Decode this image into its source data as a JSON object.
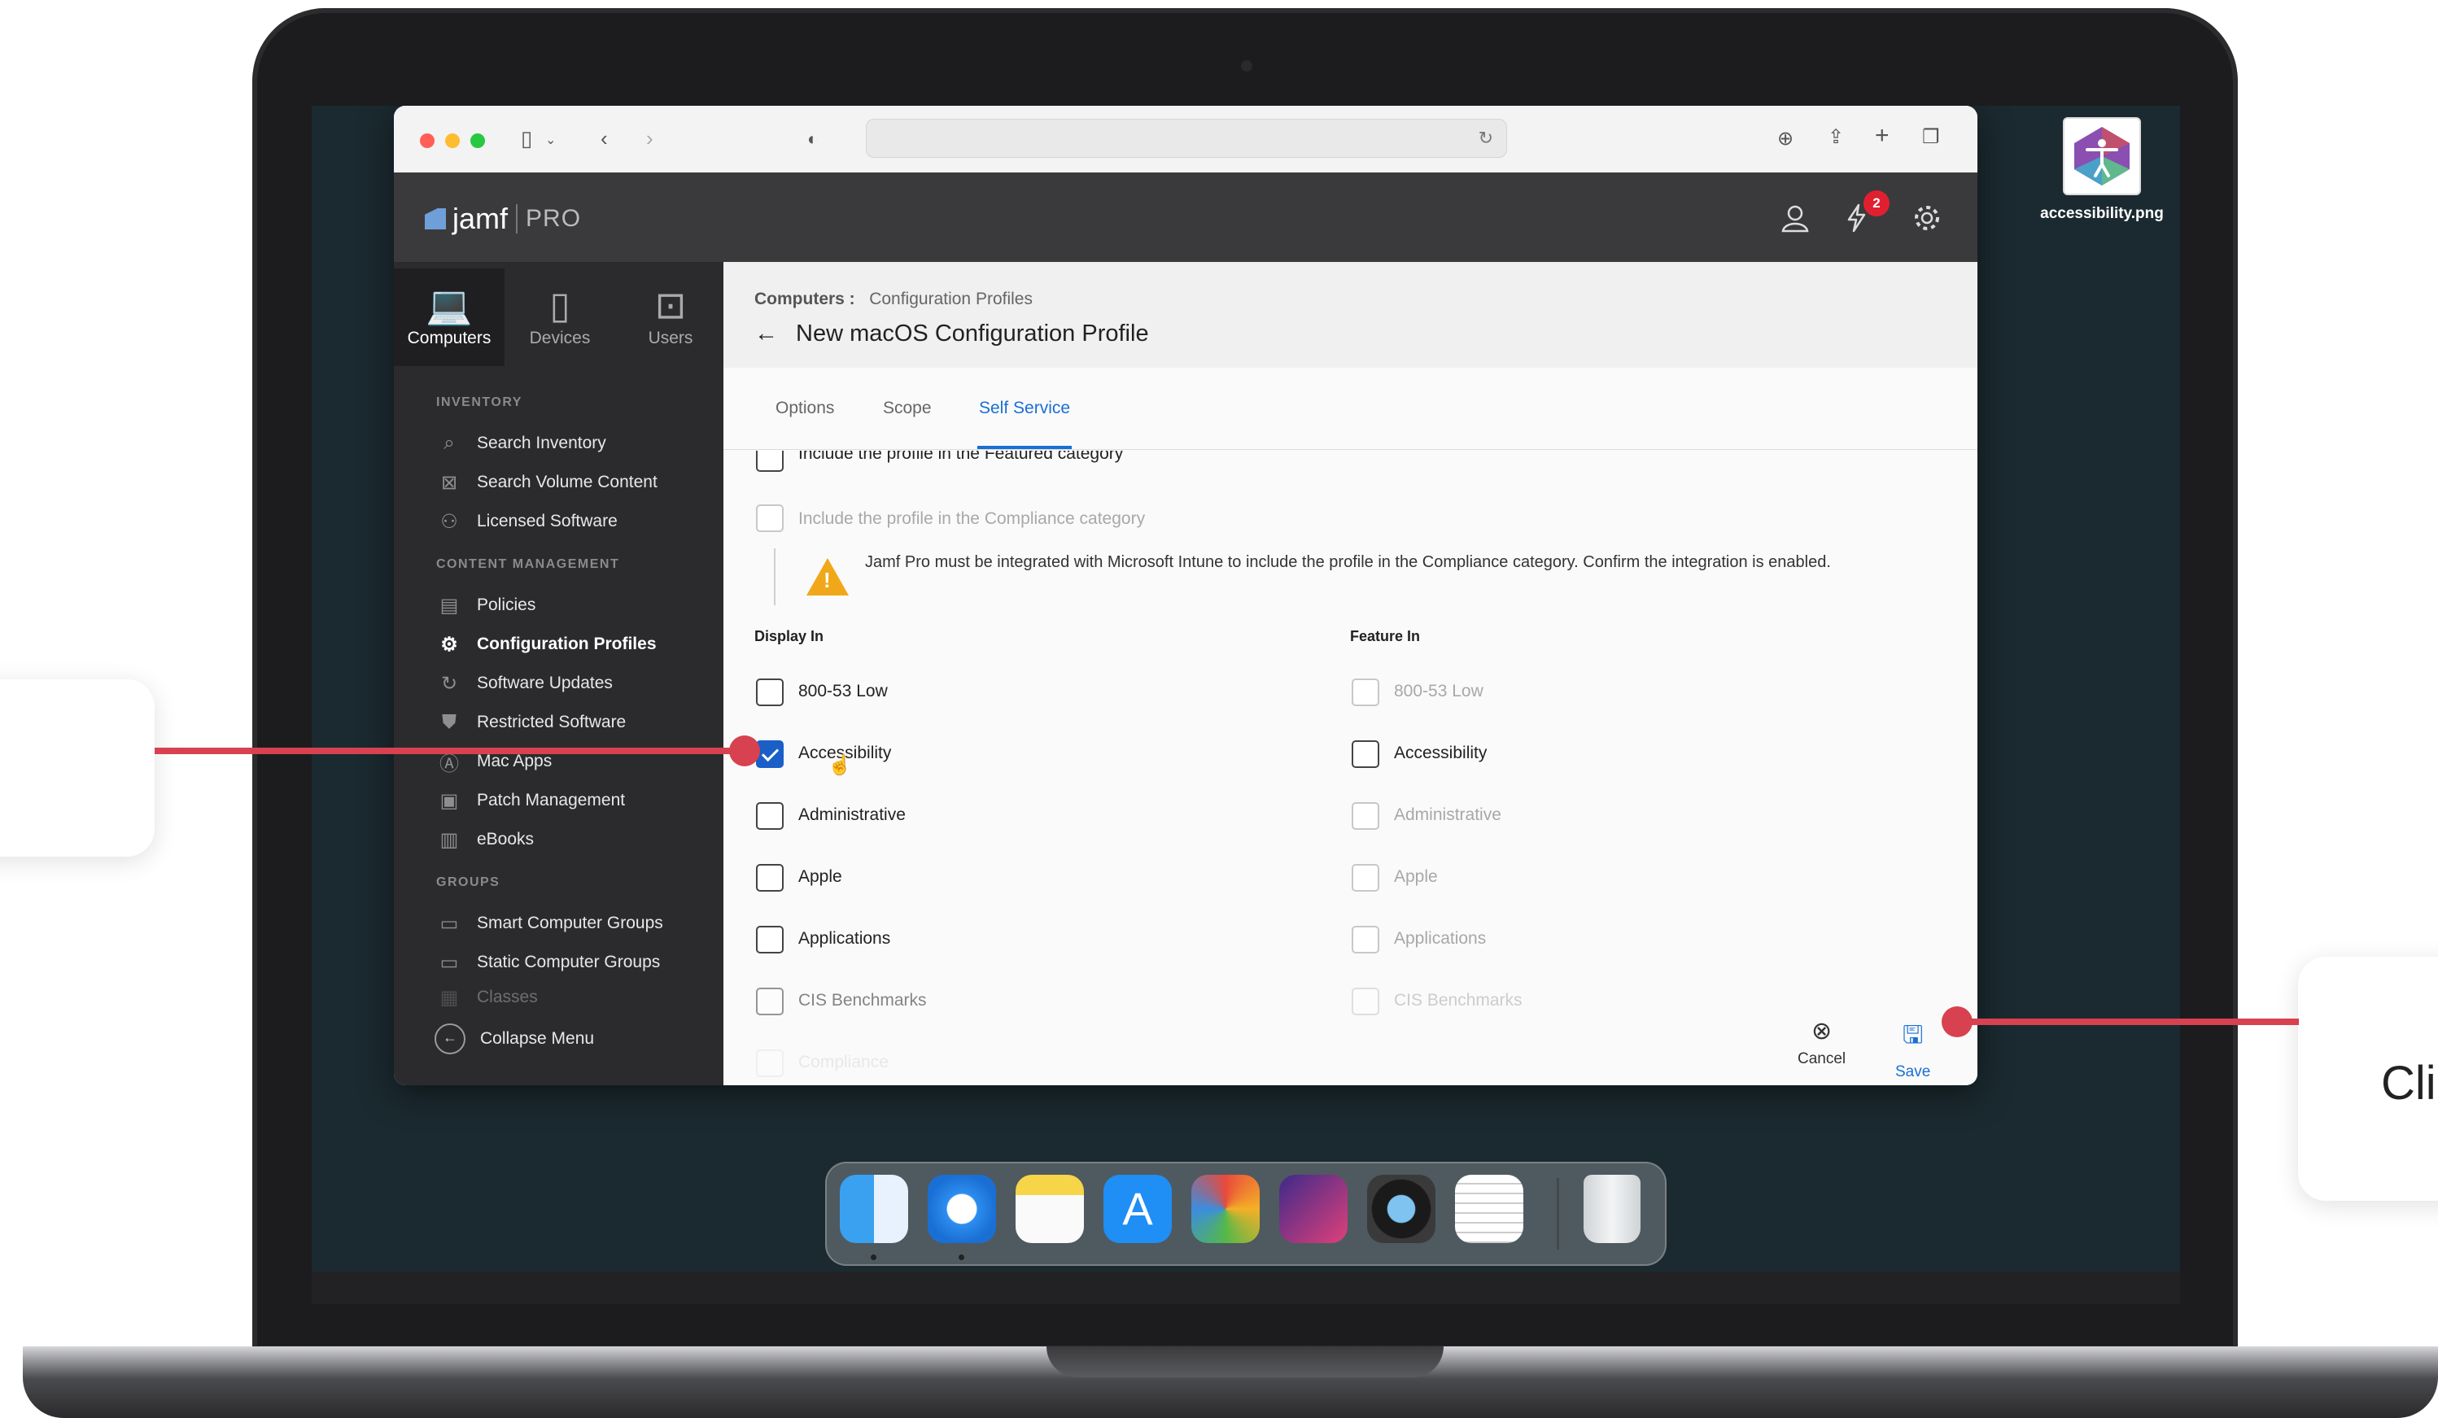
{
  "desktop": {
    "file_name": "accessibility.png"
  },
  "header": {
    "logo_text": "jamf",
    "logo_suffix": "PRO",
    "notification_count": "2"
  },
  "nav_tabs": [
    {
      "label": "Computers"
    },
    {
      "label": "Devices"
    },
    {
      "label": "Users"
    }
  ],
  "sidebar": {
    "sections": [
      "INVENTORY",
      "CONTENT MANAGEMENT",
      "GROUPS"
    ],
    "items": [
      {
        "label": "Search Inventory"
      },
      {
        "label": "Search Volume Content"
      },
      {
        "label": "Licensed Software"
      },
      {
        "label": "Policies"
      },
      {
        "label": "Configuration Profiles"
      },
      {
        "label": "Software Updates"
      },
      {
        "label": "Restricted Software"
      },
      {
        "label": "Mac Apps"
      },
      {
        "label": "Patch Management"
      },
      {
        "label": "eBooks"
      },
      {
        "label": "Smart Computer Groups"
      },
      {
        "label": "Static Computer Groups"
      },
      {
        "label": "Classes"
      }
    ],
    "collapse_label": "Collapse Menu"
  },
  "breadcrumb": {
    "root": "Computers :",
    "current": "Configuration Profiles"
  },
  "page_title": "New macOS Configuration Profile",
  "tabs": [
    {
      "label": "Options"
    },
    {
      "label": "Scope"
    },
    {
      "label": "Self Service"
    }
  ],
  "options": {
    "featured_label": "Include the profile in the Featured category",
    "compliance_label": "Include the profile in the Compliance category",
    "warning_text": "Jamf Pro must be integrated with Microsoft Intune to include the profile in the Compliance category. Confirm the integration is enabled."
  },
  "columns": {
    "display_in": "Display In",
    "feature_in": "Feature In"
  },
  "categories": [
    {
      "label": "800-53 Low",
      "display_checked": false,
      "feature_enabled": false
    },
    {
      "label": "Accessibility",
      "display_checked": true,
      "feature_enabled": true
    },
    {
      "label": "Administrative",
      "display_checked": false,
      "feature_enabled": false
    },
    {
      "label": "Apple",
      "display_checked": false,
      "feature_enabled": false
    },
    {
      "label": "Applications",
      "display_checked": false,
      "feature_enabled": false
    },
    {
      "label": "CIS Benchmarks",
      "display_checked": false,
      "feature_enabled": false
    },
    {
      "label": "Compliance",
      "display_checked": false,
      "feature_enabled": false
    }
  ],
  "footer": {
    "cancel_label": "Cancel",
    "save_label": "Save"
  },
  "callout_right_text": "Cli",
  "colors": {
    "accent": "#1a6fd4",
    "callout": "#d8414f",
    "warning": "#f0a81a"
  }
}
